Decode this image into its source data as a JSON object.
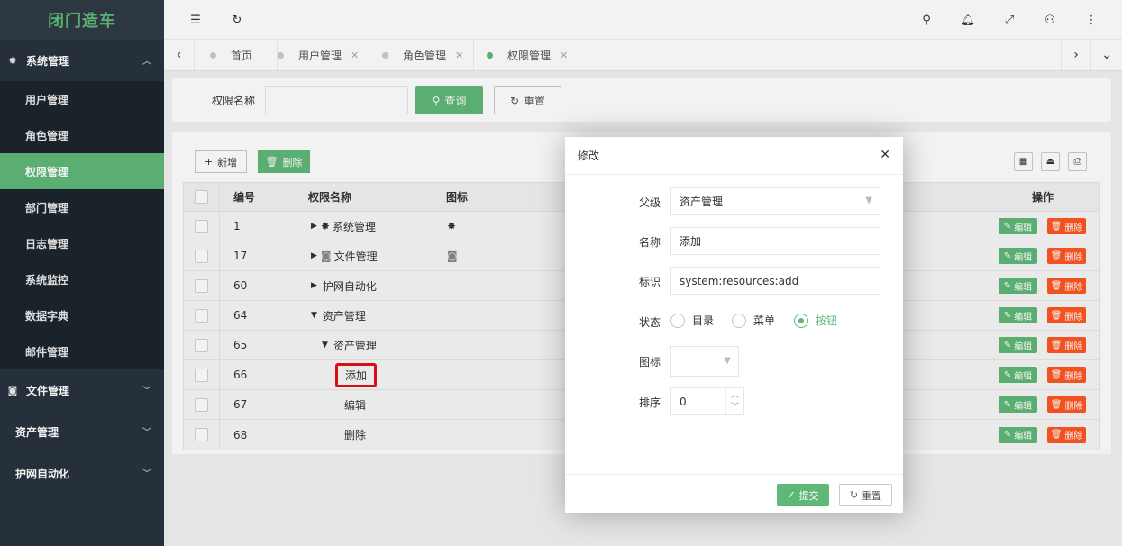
{
  "sidebar": {
    "logo": "闭门造车",
    "groups": [
      {
        "label": "系统管理",
        "icon": "gear-icon",
        "chevron": "⌃"
      },
      {
        "label": "文件管理",
        "icon": "camera-icon",
        "chevron": "⌄"
      },
      {
        "label": "资产管理",
        "chevron": "⌄"
      },
      {
        "label": "护网自动化",
        "chevron": "⌄"
      }
    ],
    "items": [
      "用户管理",
      "角色管理",
      "权限管理",
      "部门管理",
      "日志管理",
      "系统监控",
      "数据字典",
      "邮件管理"
    ]
  },
  "tabs": [
    {
      "label": "首页"
    },
    {
      "label": "用户管理"
    },
    {
      "label": "角色管理"
    },
    {
      "label": "权限管理"
    }
  ],
  "search": {
    "label": "权限名称",
    "value": "",
    "query_label": "查询",
    "reset_label": "重置"
  },
  "toolbar": {
    "add_label": "新增",
    "delete_label": "删除"
  },
  "table": {
    "headers": {
      "id": "编号",
      "name": "权限名称",
      "icon": "图标",
      "actions": "操作"
    },
    "edit_label": "编辑",
    "delete_label": "删除",
    "rows": [
      {
        "id": "1",
        "name": "系统管理"
      },
      {
        "id": "17",
        "name": "文件管理"
      },
      {
        "id": "60",
        "name": "护网自动化"
      },
      {
        "id": "64",
        "name": "资产管理"
      },
      {
        "id": "65",
        "name": "资产管理"
      },
      {
        "id": "66",
        "name": "添加"
      },
      {
        "id": "67",
        "name": "编辑"
      },
      {
        "id": "68",
        "name": "删除"
      }
    ]
  },
  "modal": {
    "title": "修改",
    "fields": {
      "parent_label": "父级",
      "parent_value": "资产管理",
      "name_label": "名称",
      "name_value": "添加",
      "perm_label": "标识",
      "perm_value": "system:resources:add",
      "status_label": "状态",
      "status_options": [
        "目录",
        "菜单",
        "按钮"
      ],
      "status_selected": "按钮",
      "icon_label": "图标",
      "sort_label": "排序",
      "sort_value": "0"
    },
    "submit_label": "提交",
    "reset_label": "重置"
  },
  "colors": {
    "accent": "#5fb878",
    "danger": "#ff5722",
    "sidebar": "#28333e",
    "highlight_box": "#e0101a"
  }
}
